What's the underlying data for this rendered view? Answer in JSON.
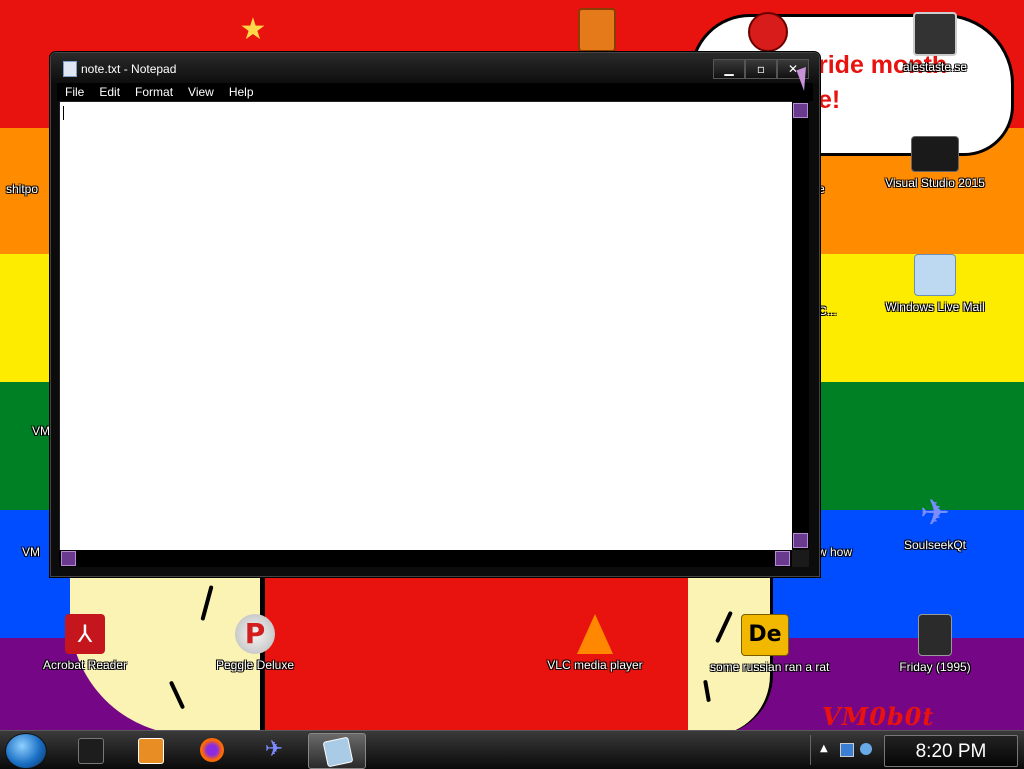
{
  "window": {
    "title": "note.txt - Notepad",
    "minimize_glyph": "▁",
    "maximize_glyph": "▫",
    "close_glyph": "✕",
    "menu": [
      "File",
      "Edit",
      "Format",
      "View",
      "Help"
    ],
    "text_content": ""
  },
  "desktop": {
    "bubble_lines": [
      "ride month",
      "e!"
    ],
    "watermark": "VM0b0t",
    "icons": [
      {
        "label": "alestaste.se",
        "icon": "stacked-windows-icon",
        "color": "#333333"
      },
      {
        "label": "Visual Studio 2015",
        "icon": "text-document-dark-icon",
        "color": "#1a1a1a"
      },
      {
        "label": "Windows Live Mail",
        "icon": "mail-icon",
        "color": "#bcd9f1"
      },
      {
        "label": "SoulseekQt",
        "icon": "bird-icon",
        "color": "#3a55d9"
      },
      {
        "label": "Friday (1995)",
        "icon": "movie-icon",
        "color": "#2b2b2b"
      },
      {
        "label": "Acrobat Reader",
        "icon": "acrobat-icon",
        "color": "#c4161c"
      },
      {
        "label": "Peggle Deluxe",
        "icon": "peggle-icon",
        "color": "#d21e1e"
      },
      {
        "label": "VLC media player",
        "icon": "vlc-cone-icon",
        "color": "#ff8800"
      },
      {
        "label": "some russian ran a rat",
        "icon": "de-icon",
        "color": "#f2b800"
      }
    ],
    "partial_labels": [
      "shitpo",
      "VM",
      "VM",
      "e",
      "C...",
      "w how"
    ]
  },
  "taskbar": {
    "clock": "8:20 PM",
    "buttons": [
      {
        "name": "app-black-icon",
        "color": "#1d1d1d"
      },
      {
        "name": "media-player-icon",
        "color": "#e88c24"
      },
      {
        "name": "firefox-icon",
        "color": "#ff6a00"
      },
      {
        "name": "soulseek-bird-icon",
        "color": "#4b4bd4"
      },
      {
        "name": "notepad-icon",
        "color": "#a9cbe6"
      }
    ]
  }
}
